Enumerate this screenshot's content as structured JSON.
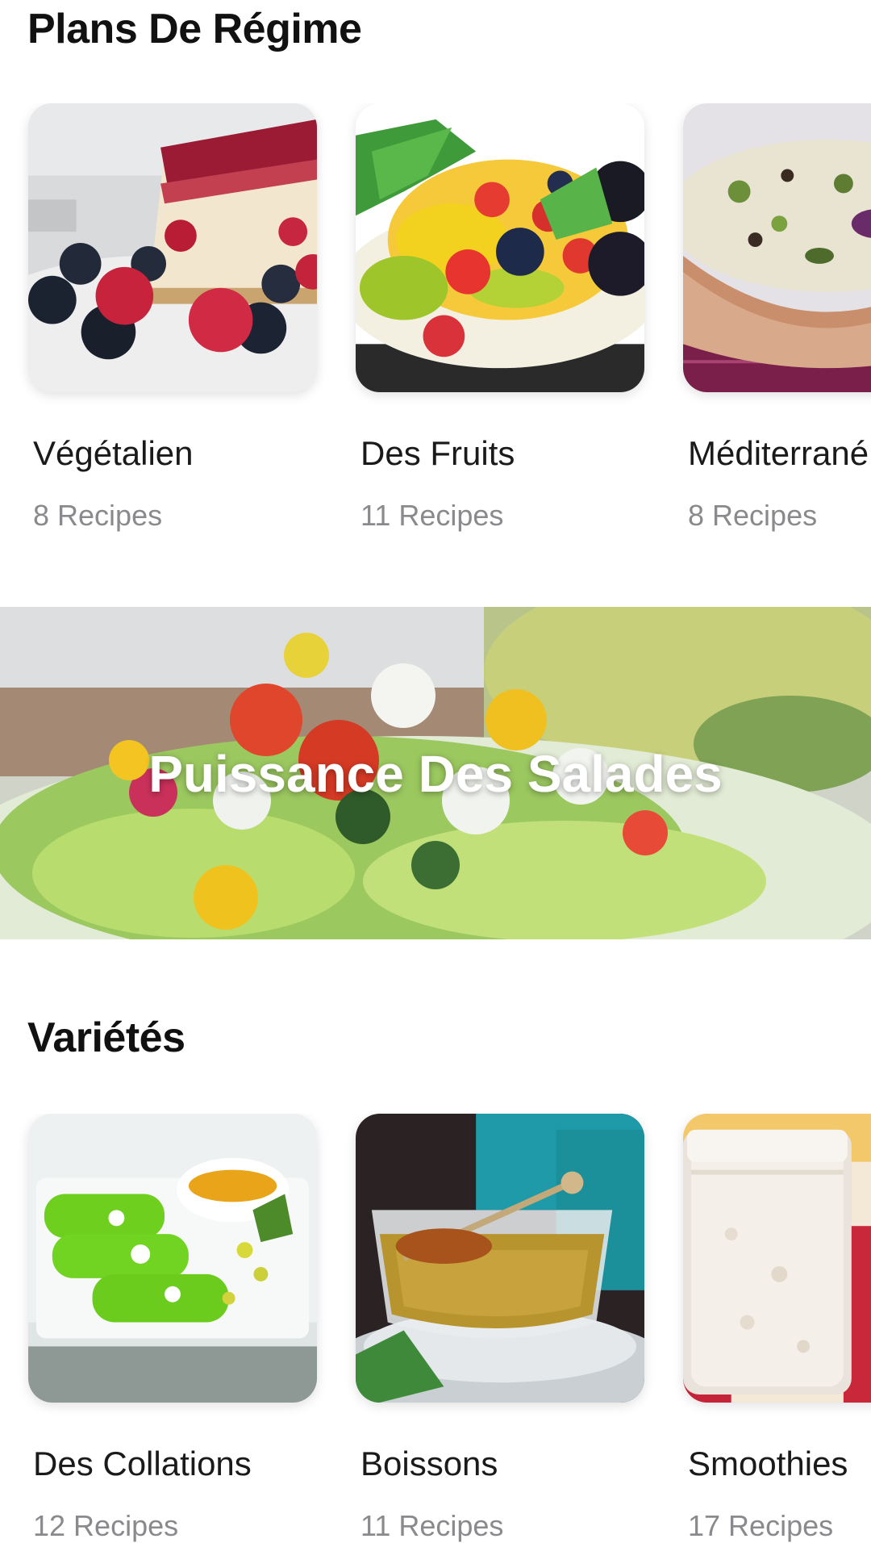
{
  "diet_plans": {
    "title": "Plans De Régime",
    "cards": [
      {
        "name": "Végétalien",
        "count": "8 Recipes",
        "image": "cheesecake-berries-photo"
      },
      {
        "name": "Des Fruits",
        "count": "11 Recipes",
        "image": "fruit-salad-photo"
      },
      {
        "name": "Méditerrané",
        "count": "8 Recipes",
        "image": "grain-salad-bowl-photo"
      }
    ]
  },
  "banner": {
    "title": "Puissance Des Salades",
    "image": "salad-plate-photo"
  },
  "varieties": {
    "title": "Variétés",
    "cards": [
      {
        "name": "Des Collations",
        "count": "12 Recipes",
        "image": "green-crepes-photo"
      },
      {
        "name": "Boissons",
        "count": "11 Recipes",
        "image": "tea-cup-photo"
      },
      {
        "name": "Smoothies",
        "count": "17 Recipes",
        "image": "smoothie-jar-photo"
      }
    ]
  }
}
